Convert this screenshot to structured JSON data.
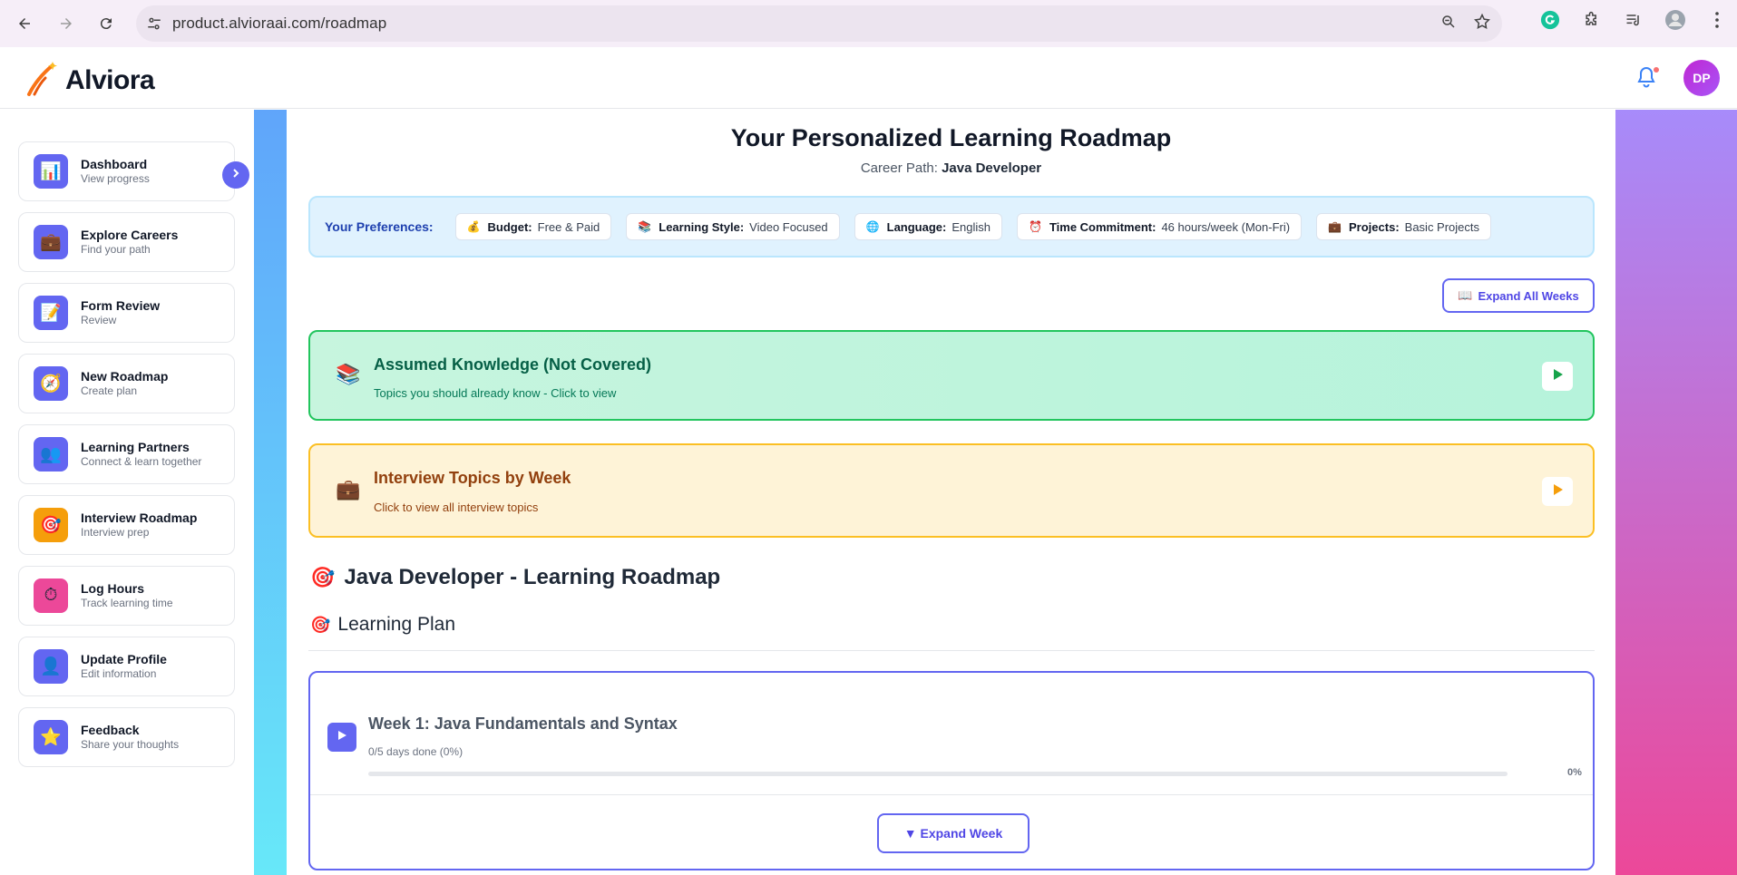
{
  "browser": {
    "url": "product.alvioraai.com/roadmap"
  },
  "header": {
    "app_name": "Alviora",
    "avatar_initials": "DP"
  },
  "sidebar": {
    "items": [
      {
        "title": "Dashboard",
        "subtitle": "View progress",
        "icon": "bar-chart-icon",
        "color": "#6366f1"
      },
      {
        "title": "Explore Careers",
        "subtitle": "Find your path",
        "icon": "briefcase-icon",
        "color": "#6366f1"
      },
      {
        "title": "Form Review",
        "subtitle": "Review",
        "icon": "memo-icon",
        "color": "#6366f1"
      },
      {
        "title": "New Roadmap",
        "subtitle": "Create plan",
        "icon": "compass-icon",
        "color": "#6366f1"
      },
      {
        "title": "Learning Partners",
        "subtitle": "Connect & learn together",
        "icon": "people-icon",
        "color": "#6366f1"
      },
      {
        "title": "Interview Roadmap",
        "subtitle": "Interview prep",
        "icon": "target-icon",
        "color": "#f59e0b"
      },
      {
        "title": "Log Hours",
        "subtitle": "Track learning time",
        "icon": "stopwatch-icon",
        "color": "#ec4899"
      },
      {
        "title": "Update Profile",
        "subtitle": "Edit information",
        "icon": "person-icon",
        "color": "#6366f1"
      },
      {
        "title": "Feedback",
        "subtitle": "Share your thoughts",
        "icon": "star-icon",
        "color": "#6366f1"
      }
    ]
  },
  "main": {
    "title": "Your Personalized Learning Roadmap",
    "career_path_label": "Career Path:",
    "career_path_value": "Java Developer",
    "preferences": {
      "label": "Your Preferences:",
      "items": [
        {
          "icon": "money-bag-icon",
          "key": "Budget:",
          "value": "Free & Paid"
        },
        {
          "icon": "books-icon",
          "key": "Learning Style:",
          "value": "Video Focused"
        },
        {
          "icon": "globe-icon",
          "key": "Language:",
          "value": "English"
        },
        {
          "icon": "alarm-clock-icon",
          "key": "Time Commitment:",
          "value": "46 hours/week (Mon-Fri)"
        },
        {
          "icon": "briefcase-icon",
          "key": "Projects:",
          "value": "Basic Projects"
        }
      ]
    },
    "expand_all_label": "Expand All Weeks",
    "assumed_knowledge": {
      "title": "Assumed Knowledge (Not Covered)",
      "subtitle": "Topics you should already know - Click to view"
    },
    "interview_topics": {
      "title": "Interview Topics by Week",
      "subtitle": "Click to view all interview topics"
    },
    "roadmap_heading": "Java Developer - Learning Roadmap",
    "plan_heading": "Learning Plan",
    "week": {
      "title": "Week 1: Java Fundamentals and Syntax",
      "progress_text": "0/5 days done (0%)",
      "progress_percent_label": "0%",
      "progress_fraction": 0,
      "expand_label": "▼ Expand Week"
    }
  },
  "colors": {
    "accent": "#6366f1",
    "green_border": "#22c55e",
    "yellow_border": "#fbbf24"
  }
}
